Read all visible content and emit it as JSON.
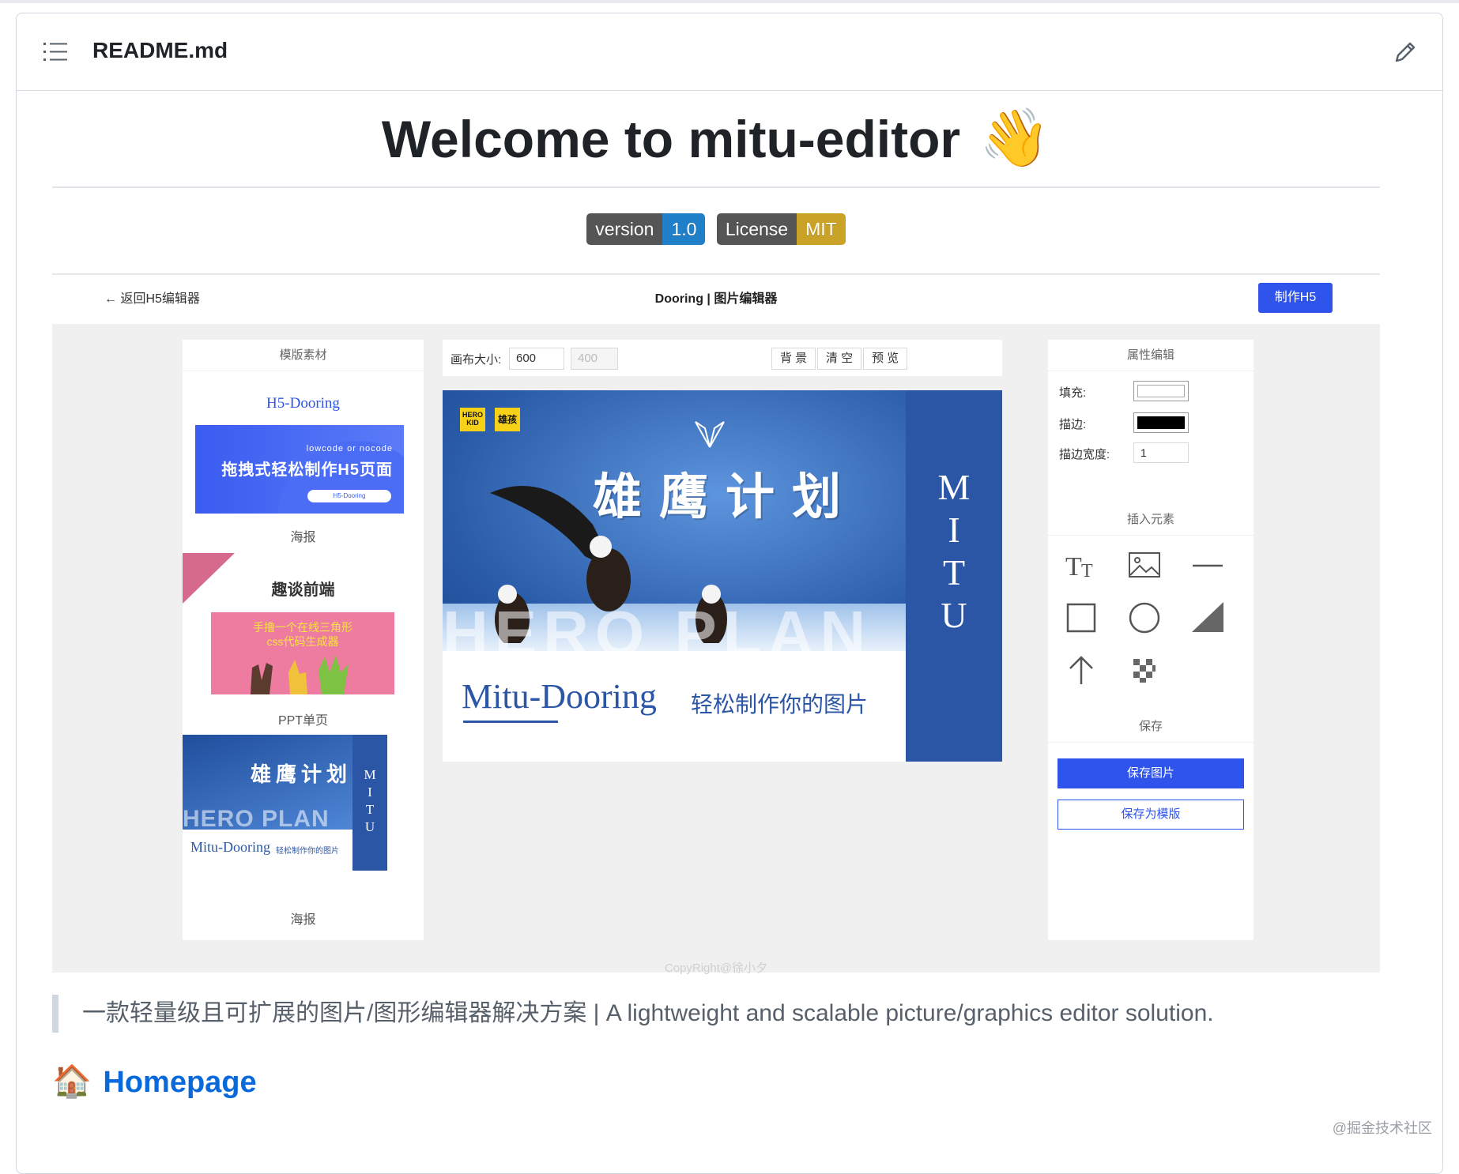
{
  "file": {
    "name": "README.md"
  },
  "readme": {
    "title": "Welcome to mitu-editor",
    "title_emoji": "👋",
    "badges": [
      {
        "label": "version",
        "value": "1.0",
        "color": "#1f7fc8"
      },
      {
        "label": "License",
        "value": "MIT",
        "color": "#c9a227"
      }
    ],
    "quote": "一款轻量级且可扩展的图片/图形编辑器解决方案 | A lightweight and scalable picture/graphics editor solution.",
    "homepage_heading": "Homepage",
    "homepage_emoji": "🏠"
  },
  "app": {
    "back_link": "← 返回H5编辑器",
    "title": "Dooring | 图片编辑器",
    "make_button": "制作H5",
    "left_panel": {
      "title": "模版素材",
      "tpl1_heading": "H5-Dooring",
      "tpl1_small": "lowcode or nocode",
      "tpl1_big": "拖拽式轻松制作H5页面",
      "tpl1_pill": "H5-Dooring",
      "tpl1_label": "海报",
      "tpl2_title": "趣谈前端",
      "tpl2_text": "手撸一个在线三角形\ncss代码生成器",
      "tpl2_label": "PPT单页",
      "tpl3_label": "海报"
    },
    "toolbar": {
      "size_label": "画布大小:",
      "width": "600",
      "height": "400",
      "bg_button": "背 景",
      "clear_button": "清 空",
      "preview_button": "预 览"
    },
    "canvas": {
      "logo1": "HERO KID",
      "logo2": "雄孩",
      "headline": "雄鹰计划",
      "watermark_text": "HERO PLAN",
      "side_letters": [
        "M",
        "I",
        "T",
        "U"
      ],
      "brand": "Mitu-Dooring",
      "tagline": "轻松制作你的图片"
    },
    "right_panel": {
      "title": "属性编辑",
      "fill_label": "填充:",
      "stroke_label": "描边:",
      "stroke_width_label": "描边宽度:",
      "stroke_width": "1",
      "insert_title": "插入元素",
      "save_title": "保存",
      "save_image_button": "保存图片",
      "save_template_button": "保存为模版"
    },
    "copyright": "CopyRight@徐小夕"
  },
  "watermark": "@掘金技术社区",
  "colors": {
    "accent": "#2f54eb",
    "link": "#0969da",
    "canvas_blue": "#2b56a5"
  }
}
